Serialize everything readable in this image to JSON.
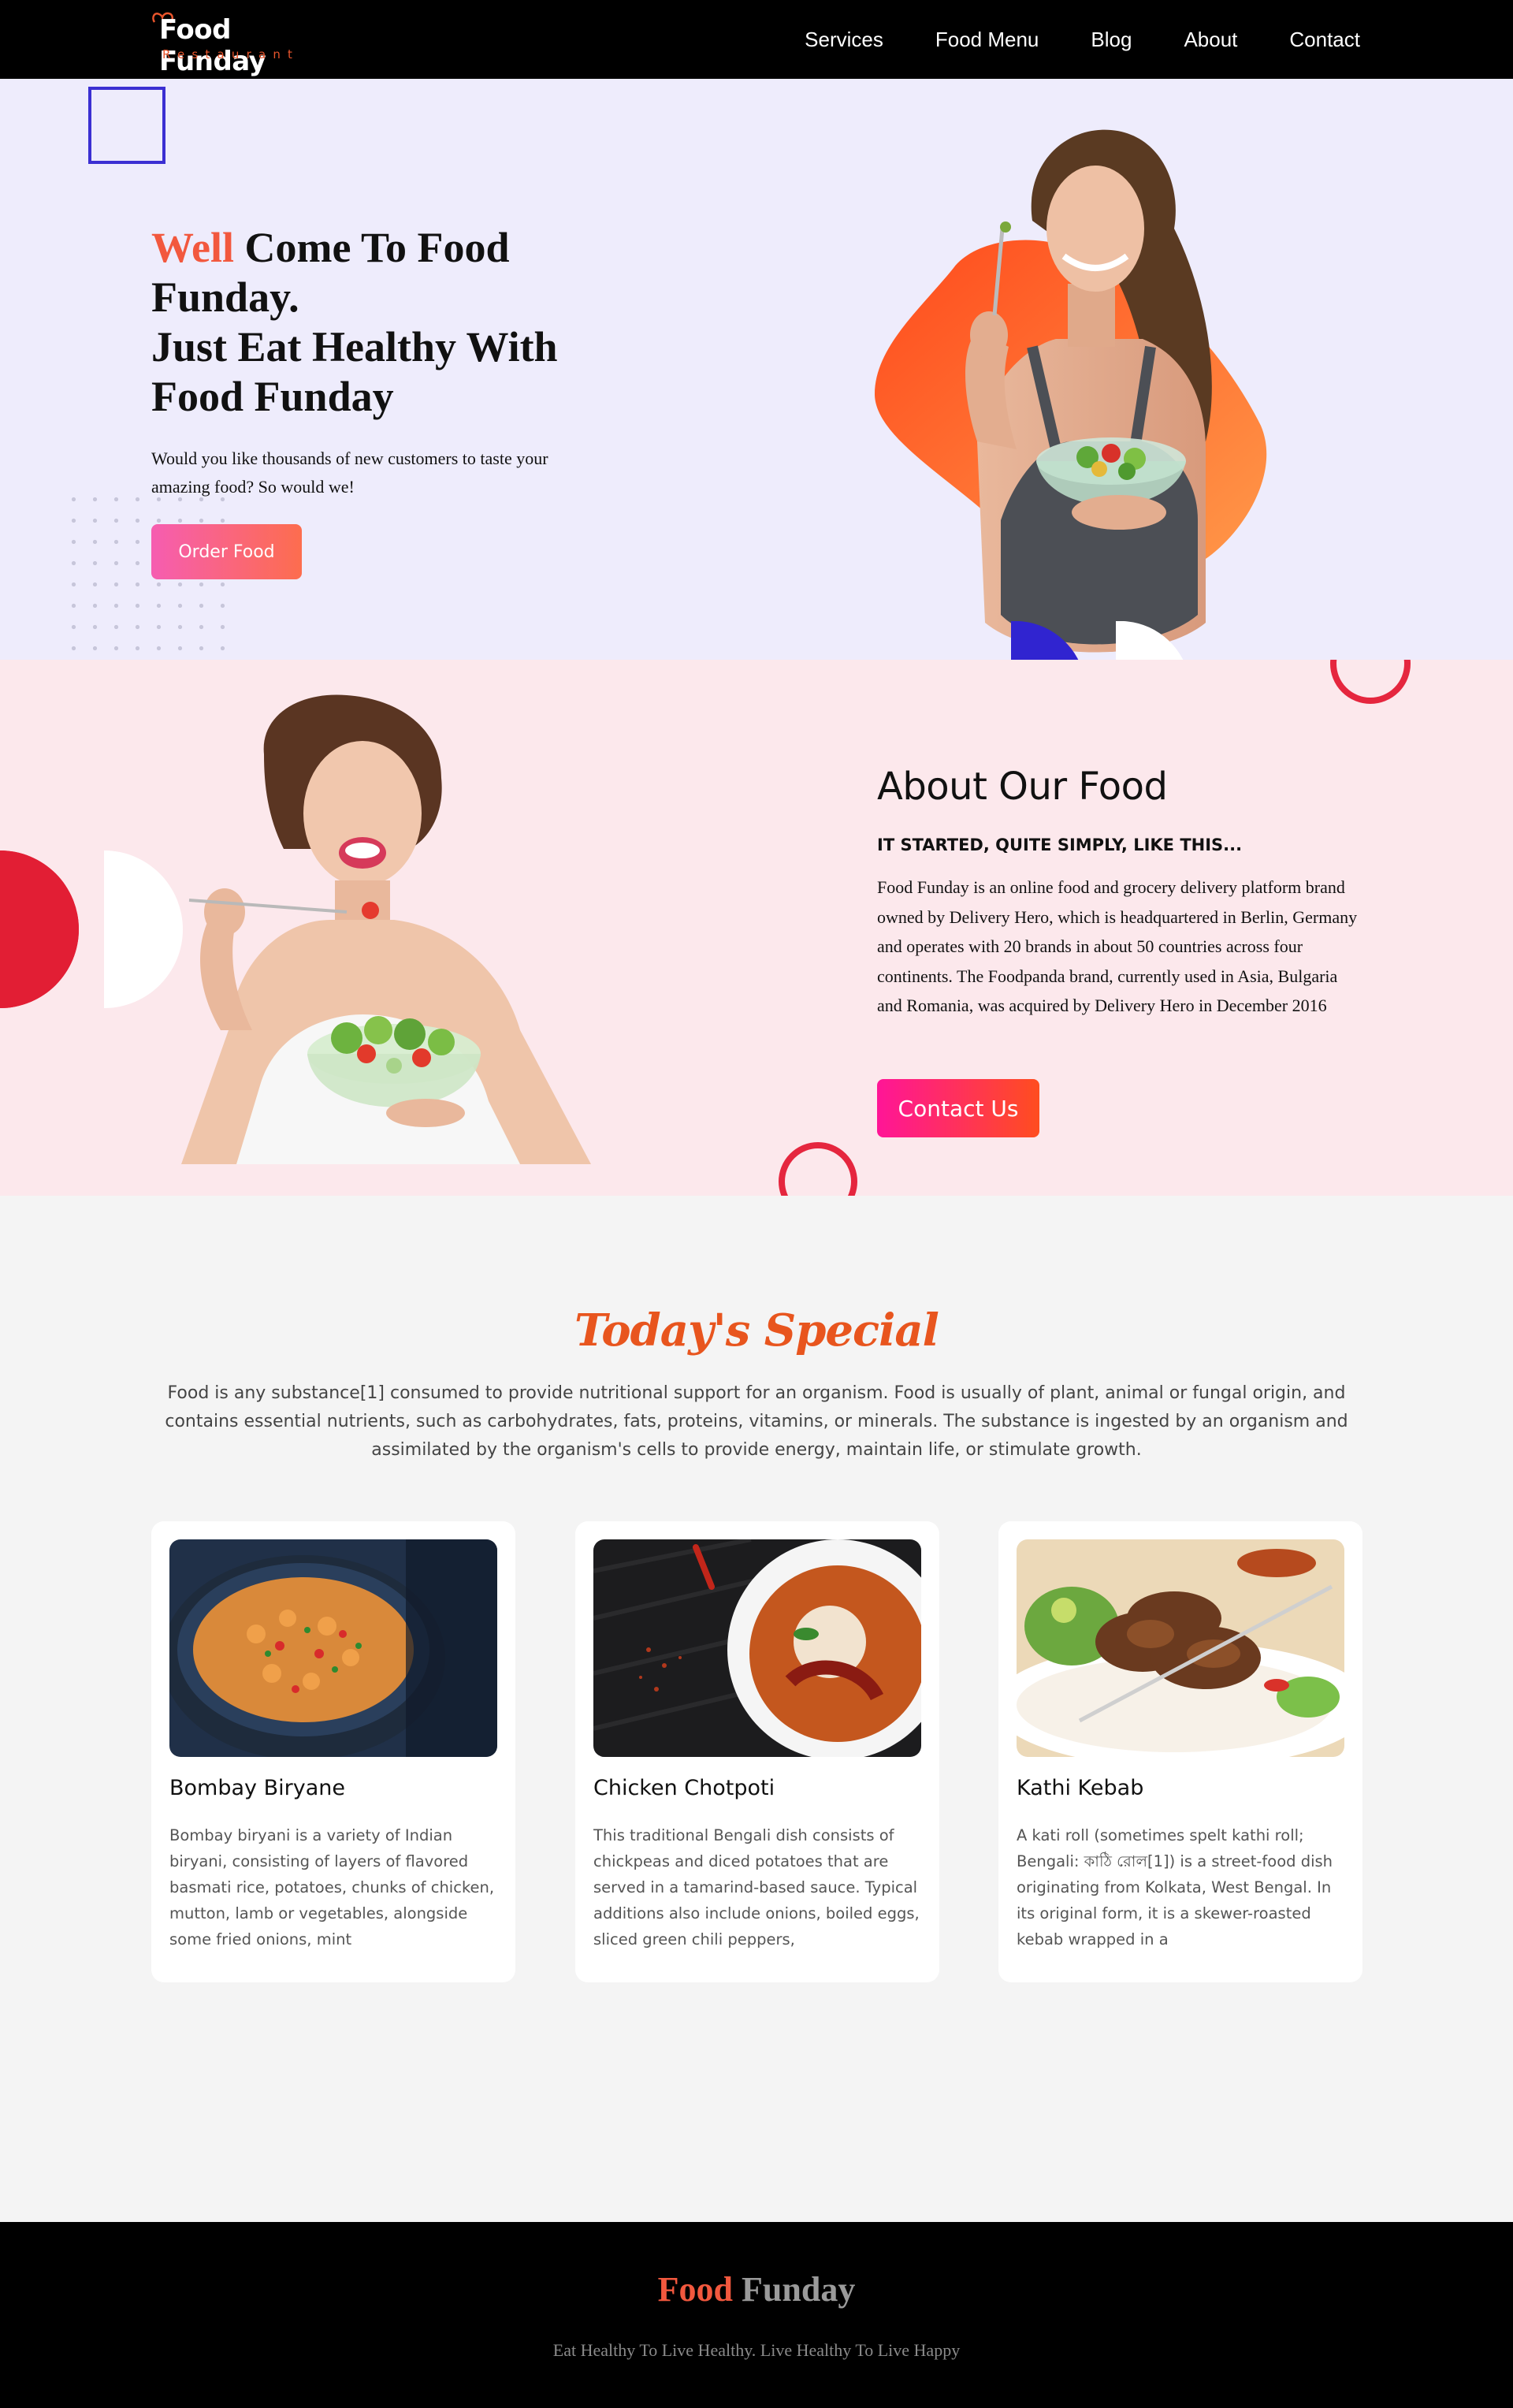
{
  "brand": {
    "name": "Food Funday",
    "tagline": "Restaurant"
  },
  "nav": {
    "items": [
      "Services",
      "Food Menu",
      "Blog",
      "About",
      "Contact"
    ]
  },
  "hero": {
    "title_accent": "Well",
    "title_rest": " Come To Food Funday.",
    "title_line2": "Just Eat Healthy With Food Funday",
    "description": "Would you like thousands of new customers to taste your amazing food? So would we!",
    "button_label": "Order Food"
  },
  "about": {
    "title": "About Our Food",
    "subtitle": "IT STARTED, QUITE SIMPLY, LIKE THIS...",
    "text": "Food Funday is an online food and grocery delivery platform brand owned by Delivery Hero, which is headquartered in Berlin, Germany and operates with 20 brands in about 50 countries across four continents. The Foodpanda brand, currently used in Asia, Bulgaria and Romania, was acquired by Delivery Hero in December 2016",
    "button_label": "Contact Us"
  },
  "special": {
    "title": "Today's Special",
    "description": "Food is any substance[1] consumed to provide nutritional support for an organism. Food is usually of plant, animal or fungal origin, and contains essential nutrients, such as carbohydrates, fats, proteins, vitamins, or minerals. The substance is ingested by an organism and assimilated by the organism's cells to provide energy, maintain life, or stimulate growth.",
    "cards": [
      {
        "name": "Bombay Biryane",
        "description": "Bombay biryani is a variety of Indian biryani, consisting of layers of flavored basmati rice, potatoes, chunks of chicken, mutton, lamb or vegetables, alongside some fried onions, mint"
      },
      {
        "name": "Chicken Chotpoti",
        "description": "This traditional Bengali dish consists of chickpeas and diced potatoes that are served in a tamarind-based sauce. Typical additions also include onions, boiled eggs, sliced green chili peppers,"
      },
      {
        "name": "Kathi Kebab",
        "description": "A kati roll (sometimes spelt kathi roll; Bengali: কাঠি রোল[1]) is a street-food dish originating from Kolkata, West Bengal. In its original form, it is a skewer-roasted kebab wrapped in a"
      }
    ]
  },
  "footer": {
    "brand_a": "Food",
    "brand_b": "Funday",
    "tagline": "Eat Healthy To Live Healthy. Live Healthy To Live Happy"
  },
  "colors": {
    "accent": "#f2583e",
    "hero_bg": "#eeecfc",
    "about_bg": "#fce8ec",
    "special_title": "#e8551e",
    "ring": "#e5263e",
    "square": "#3b2fd2"
  }
}
